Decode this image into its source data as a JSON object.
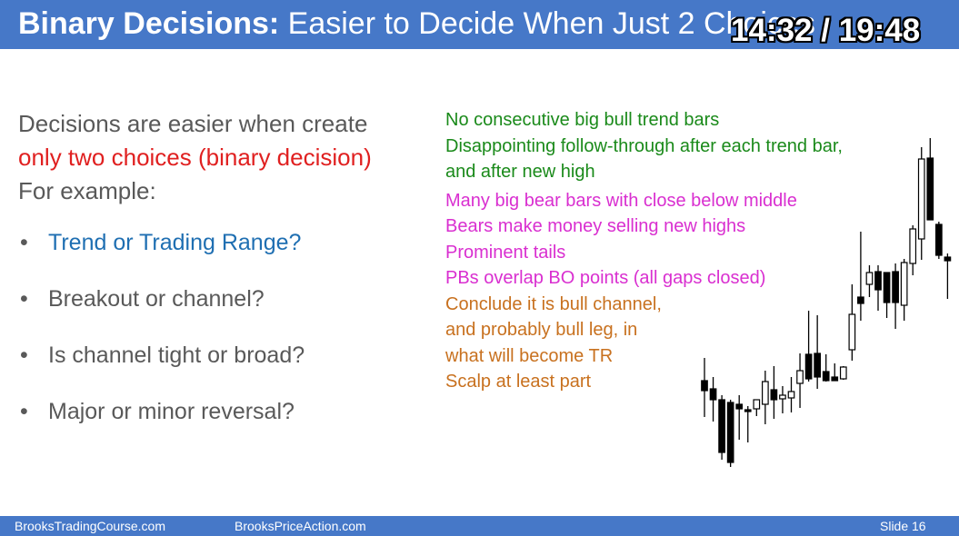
{
  "slide": {
    "title_bold": "Binary Decisions:",
    "title_rest": " Easier to Decide When Just 2 Choices",
    "timer": "14:32 / 19:48"
  },
  "intro": {
    "line1": "Decisions are easier when create",
    "line2": "only two choices (binary decision)",
    "line3": "For example:"
  },
  "bullets": [
    "Trend or Trading Range?",
    "Breakout or channel?",
    "Is channel tight or broad?",
    "Major or minor reversal?"
  ],
  "notes": {
    "green": [
      "No consecutive big bull trend bars",
      "Disappointing follow-through after each trend bar,",
      "and after new high"
    ],
    "magenta": [
      "Many big bear bars with close below middle",
      "Bears make money selling new highs",
      "Prominent tails",
      "PBs overlap BO points (all gaps closed)"
    ],
    "orange": [
      "Conclude it is bull channel,",
      "and probably bull leg, in",
      "what will become TR",
      "Scalp at least part"
    ]
  },
  "footer": {
    "left": "BrooksTradingCourse.com",
    "center": "BrooksPriceAction.com",
    "slide": "Slide  16"
  },
  "colors": {
    "bar": "#4678c8",
    "green": "#1a8a1a",
    "magenta": "#d92fd0",
    "orange": "#c8711f",
    "red": "#e02020",
    "blue": "#1f6fb2"
  },
  "chart_data": {
    "type": "candlestick",
    "note": "unlabeled price bars; relative values read from image (higher = higher price)",
    "candles": [
      {
        "o": 171,
        "h": 196,
        "l": 131,
        "c": 160
      },
      {
        "o": 162,
        "h": 175,
        "l": 126,
        "c": 150
      },
      {
        "o": 150,
        "h": 155,
        "l": 84,
        "c": 92
      },
      {
        "o": 147,
        "h": 150,
        "l": 76,
        "c": 81
      },
      {
        "o": 145,
        "h": 155,
        "l": 106,
        "c": 140
      },
      {
        "o": 139,
        "h": 143,
        "l": 103,
        "c": 138
      },
      {
        "o": 140,
        "h": 150,
        "l": 132,
        "c": 150
      },
      {
        "o": 145,
        "h": 182,
        "l": 123,
        "c": 170
      },
      {
        "o": 161,
        "h": 187,
        "l": 129,
        "c": 150
      },
      {
        "o": 151,
        "h": 165,
        "l": 135,
        "c": 155
      },
      {
        "o": 152,
        "h": 175,
        "l": 136,
        "c": 159
      },
      {
        "o": 168,
        "h": 201,
        "l": 141,
        "c": 182
      },
      {
        "o": 200,
        "h": 248,
        "l": 170,
        "c": 173
      },
      {
        "o": 201,
        "h": 243,
        "l": 162,
        "c": 175
      },
      {
        "o": 181,
        "h": 200,
        "l": 170,
        "c": 171
      },
      {
        "o": 175,
        "h": 190,
        "l": 172,
        "c": 171
      },
      {
        "o": 173,
        "h": 187,
        "l": 172,
        "c": 186
      },
      {
        "o": 205,
        "h": 277,
        "l": 193,
        "c": 244
      },
      {
        "o": 263,
        "h": 335,
        "l": 237,
        "c": 256
      },
      {
        "o": 277,
        "h": 298,
        "l": 263,
        "c": 290
      },
      {
        "o": 291,
        "h": 298,
        "l": 248,
        "c": 271
      },
      {
        "o": 290,
        "h": 289,
        "l": 240,
        "c": 257
      },
      {
        "o": 291,
        "h": 300,
        "l": 228,
        "c": 257
      },
      {
        "o": 254,
        "h": 305,
        "l": 237,
        "c": 301
      },
      {
        "o": 300,
        "h": 342,
        "l": 287,
        "c": 338
      },
      {
        "o": 327,
        "h": 428,
        "l": 304,
        "c": 415
      },
      {
        "o": 416,
        "h": 438,
        "l": 350,
        "c": 348
      },
      {
        "o": 343,
        "h": 346,
        "l": 305,
        "c": 309
      },
      {
        "o": 307,
        "h": 311,
        "l": 261,
        "c": 303
      }
    ]
  }
}
